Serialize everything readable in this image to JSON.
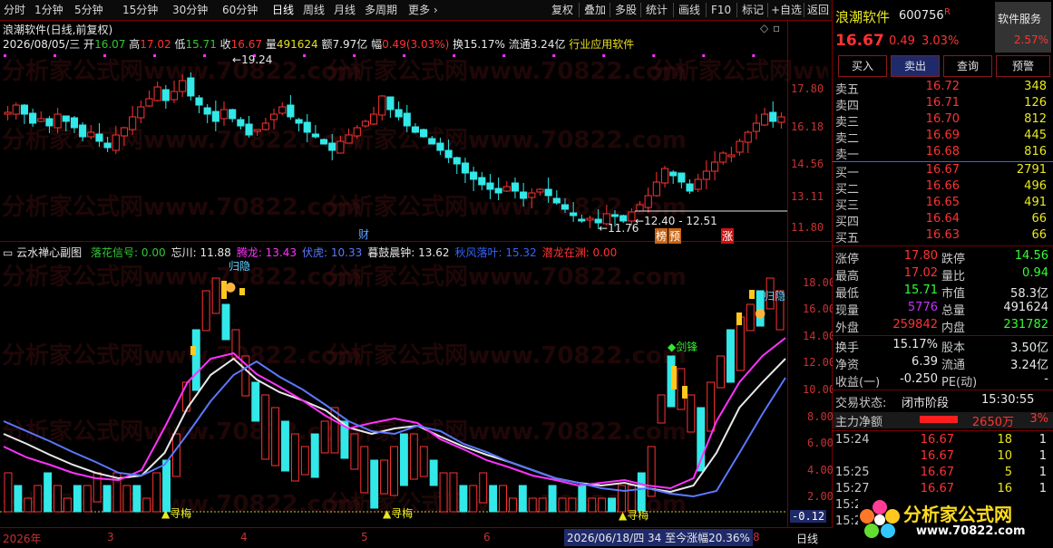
{
  "toolbar": {
    "periods": [
      "分时",
      "1分钟",
      "5分钟",
      "15分钟",
      "30分钟",
      "60分钟",
      "日线",
      "周线",
      "月线",
      "多周期",
      "更多"
    ],
    "right_buttons": [
      "复权",
      "叠加",
      "多股",
      "统计",
      "画线",
      "F10",
      "标记",
      "+自选",
      "返回"
    ]
  },
  "main_chart": {
    "title": "浪潮软件(日线,前复权)",
    "date": "2026/08/05/三",
    "open_label": "开",
    "open": "16.07",
    "high_label": "高",
    "high": "17.02",
    "low_label": "低",
    "low": "15.71",
    "close_label": "收",
    "close": "16.67",
    "volume_label": "量",
    "volume": "491624",
    "amount_label": "额",
    "amount": "7.97亿",
    "change_label": "幅",
    "change": "0.49(3.03%)",
    "turnover": "换15.17%",
    "float": "流通3.24亿",
    "industry": "行业应用软件",
    "y_ticks": [
      "17.80",
      "16.18",
      "14.56",
      "13.11",
      "11.80"
    ],
    "high_mark": "19.24",
    "low_mark": "11.76",
    "range_mark": "12.40 - 12.51",
    "event_cai": "财",
    "event_bang": "榜",
    "event_yu": "预",
    "event_zhang": "涨"
  },
  "sub_chart": {
    "name": "云水禅心副图",
    "series": [
      {
        "label": "落花信号: 0.00",
        "color": "#32c832"
      },
      {
        "label": "忘川: 11.88",
        "color": "#e8e8e8"
      },
      {
        "label": "腾龙: 13.43",
        "color": "#ff32ff"
      },
      {
        "label": "伏虎: 10.33",
        "color": "#5a78ff"
      },
      {
        "label": "暮鼓晨钟: 13.62",
        "color": "#e8e8e8"
      },
      {
        "label": "秋风落叶: 15.32",
        "color": "#3264ff"
      },
      {
        "label": "潜龙在渊: 0.00",
        "color": "#ff3232"
      }
    ],
    "y_ticks": [
      "18.00",
      "16.00",
      "14.00",
      "12.00",
      "10.00",
      "8.00",
      "6.00",
      "4.00",
      "2.00"
    ],
    "current_value": "-0.12",
    "annotations": {
      "gui_yin": "归隐",
      "xun_mei": "寻梅",
      "jian_feng": "剑锋"
    }
  },
  "bottom_axis": {
    "labels": [
      "2026年",
      "3",
      "4",
      "5",
      "6",
      "8"
    ],
    "highlight": "2026/06/18/四 34 至今涨幅20.36%",
    "period": "日线"
  },
  "watermark": "分析家公式网www.70822.com",
  "quote": {
    "name": "浪潮软件",
    "code": "600756",
    "r_mark": "R",
    "service": "软件服务",
    "service_change": "2.57%",
    "price": "16.67",
    "change": "0.49",
    "change_pct": "3.03%",
    "buttons": [
      "买入",
      "卖出",
      "查询",
      "预警"
    ],
    "asks": [
      {
        "label": "卖五",
        "price": "16.72",
        "vol": "348"
      },
      {
        "label": "卖四",
        "price": "16.71",
        "vol": "126"
      },
      {
        "label": "卖三",
        "price": "16.70",
        "vol": "812"
      },
      {
        "label": "卖二",
        "price": "16.69",
        "vol": "445"
      },
      {
        "label": "卖一",
        "price": "16.68",
        "vol": "816"
      }
    ],
    "bids": [
      {
        "label": "买一",
        "price": "16.67",
        "vol": "2791"
      },
      {
        "label": "买二",
        "price": "16.66",
        "vol": "496"
      },
      {
        "label": "买三",
        "price": "16.65",
        "vol": "491"
      },
      {
        "label": "买四",
        "price": "16.64",
        "vol": "66"
      },
      {
        "label": "买五",
        "price": "16.63",
        "vol": "66"
      }
    ],
    "stats": [
      {
        "l1": "涨停",
        "v1": "17.80",
        "c1": "#ff3232",
        "l2": "跌停",
        "v2": "14.56",
        "c2": "#32ff32"
      },
      {
        "l1": "最高",
        "v1": "17.02",
        "c1": "#ff3232",
        "l2": "量比",
        "v2": "0.94",
        "c2": "#32ff32"
      },
      {
        "l1": "最低",
        "v1": "15.71",
        "c1": "#32ff32",
        "l2": "市值",
        "v2": "58.3亿",
        "c2": "#e8e8e8"
      },
      {
        "l1": "现量",
        "v1": "5776",
        "c1": "#c832ff",
        "l2": "总量",
        "v2": "491624",
        "c2": "#e8e8e8"
      },
      {
        "l1": "外盘",
        "v1": "259842",
        "c1": "#ff3232",
        "l2": "内盘",
        "v2": "231782",
        "c2": "#32ff32"
      }
    ],
    "stats2": [
      {
        "l1": "换手",
        "v1": "15.17%",
        "l2": "股本",
        "v2": "3.50亿"
      },
      {
        "l1": "净资",
        "v1": "6.39",
        "l2": "流通",
        "v2": "3.24亿"
      },
      {
        "l1": "收益(一)",
        "v1": "-0.250",
        "l2": "PE(动)",
        "v2": "-"
      }
    ],
    "trade_status_label": "交易状态:",
    "trade_status": "闭市阶段",
    "trade_time": "15:30:55",
    "net_flow_label": "主力净额",
    "net_flow": "2650万",
    "net_flow_pct": "3%",
    "ticks": [
      {
        "time": "15:24",
        "price": "16.67",
        "vol": "18",
        "n": "1"
      },
      {
        "time": "",
        "price": "16.67",
        "vol": "10",
        "n": "1"
      },
      {
        "time": "15:25",
        "price": "16.67",
        "vol": "5",
        "n": "1"
      },
      {
        "time": "15:27",
        "price": "16.67",
        "vol": "16",
        "n": "1"
      },
      {
        "time": "15:28",
        "price": "",
        "vol": "",
        "n": ""
      },
      {
        "time": "15:29",
        "price": "",
        "vol": "",
        "n": ""
      }
    ],
    "logo_text": "分析家公式网",
    "logo_url": "www.70822.com"
  }
}
